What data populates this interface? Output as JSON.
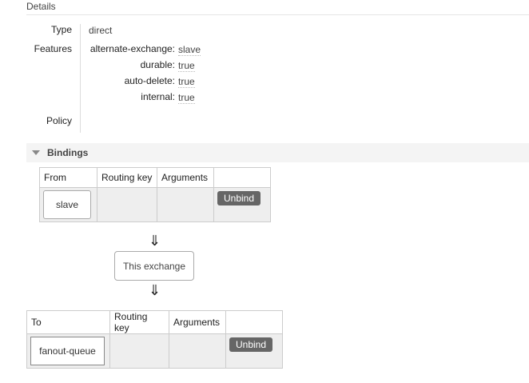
{
  "details": {
    "title": "Details",
    "type_label": "Type",
    "type_value": "direct",
    "features_label": "Features",
    "features": [
      {
        "key": "alternate-exchange:",
        "value": "slave"
      },
      {
        "key": "durable:",
        "value": "true"
      },
      {
        "key": "auto-delete:",
        "value": "true"
      },
      {
        "key": "internal:",
        "value": "true"
      }
    ],
    "policy_label": "Policy"
  },
  "bindings": {
    "title": "Bindings",
    "from_table": {
      "headers": [
        "From",
        "Routing key",
        "Arguments",
        ""
      ],
      "row": {
        "source": "slave",
        "routing_key": "",
        "arguments": "",
        "action": "Unbind"
      }
    },
    "arrow_glyph": "⇓",
    "this_exchange": "This exchange",
    "to_table": {
      "headers": [
        "To",
        "Routing key",
        "Arguments",
        ""
      ],
      "row": {
        "destination": "fanout-queue",
        "routing_key": "",
        "arguments": "",
        "action": "Unbind"
      }
    }
  }
}
